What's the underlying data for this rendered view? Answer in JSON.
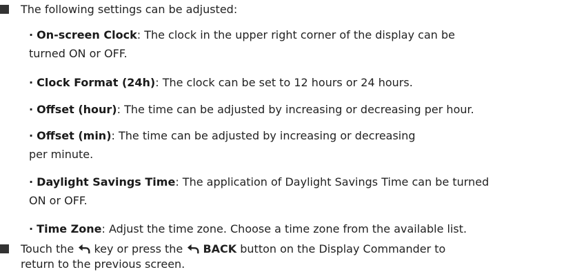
{
  "intro": {
    "text": "The following settings can be adjusted:"
  },
  "items": [
    {
      "term": "On-screen Clock",
      "desc_line1": ": The clock in the upper right corner of the display can be",
      "desc_line2": "turned ON or OFF."
    },
    {
      "term": "Clock Format (24h)",
      "desc_line1": ": The clock can be set to 12 hours or 24 hours.",
      "desc_line2": ""
    },
    {
      "term": "Offset (hour)",
      "desc_line1": ": The time can be adjusted by increasing or decreasing per hour.",
      "desc_line2": ""
    },
    {
      "term": "Offset (min)",
      "desc_line1": ": The time can be adjusted by increasing or decreasing",
      "desc_line2": "per minute."
    },
    {
      "term": "Daylight Savings Time",
      "desc_line1": ": The application of Daylight Savings Time can be turned",
      "desc_line2": "ON or OFF."
    },
    {
      "term": "Time Zone",
      "desc_line1": ": Adjust the time zone. Choose a time zone from the available list.",
      "desc_line2": ""
    }
  ],
  "footer": {
    "part1": "Touch the",
    "part2": "key or press the",
    "back_label": "BACK",
    "part3": "button on the Display Commander to",
    "line2": "return to the previous screen."
  },
  "icons": {
    "bullet": "square-bullet-icon",
    "back": "back-arrow-icon"
  },
  "colors": {
    "text": "#222222",
    "bullet": "#333333"
  }
}
